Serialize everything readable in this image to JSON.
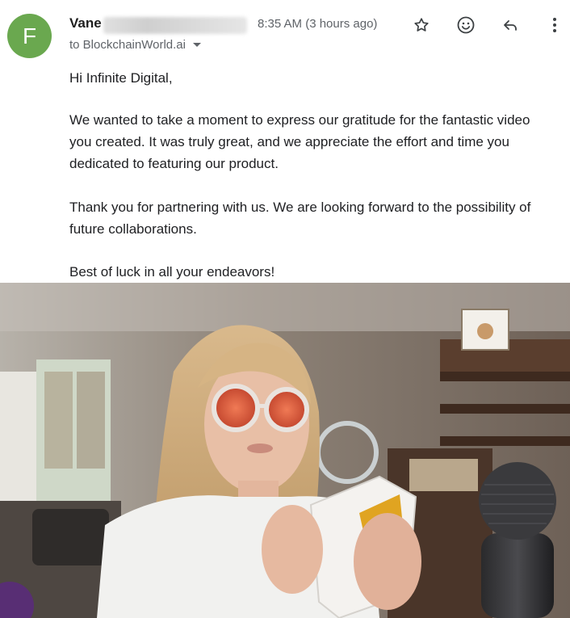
{
  "email": {
    "avatar_letter": "F",
    "sender_name_visible": "Vane",
    "time": "8:35 AM (3 hours ago)",
    "recipient": "to BlockchainWorld.ai",
    "icons": [
      "star-icon",
      "emoji-icon",
      "reply-icon",
      "more-vert-icon"
    ],
    "accent": "#6aa84f",
    "greeting": "Hi Infinite Digital,",
    "paragraph1_line1": "We wanted to take a moment to express our gratitude for the fantastic video",
    "paragraph1_line2": "you created. It was truly great, and we appreciate the effort and time you",
    "paragraph1_line3": "dedicated to featuring our product.",
    "paragraph2_line1": "Thank you for partnering with us. We are looking forward to the possibility of",
    "paragraph2_line2": "future collaborations.",
    "closing": "Best of luck in all your endeavors!"
  }
}
